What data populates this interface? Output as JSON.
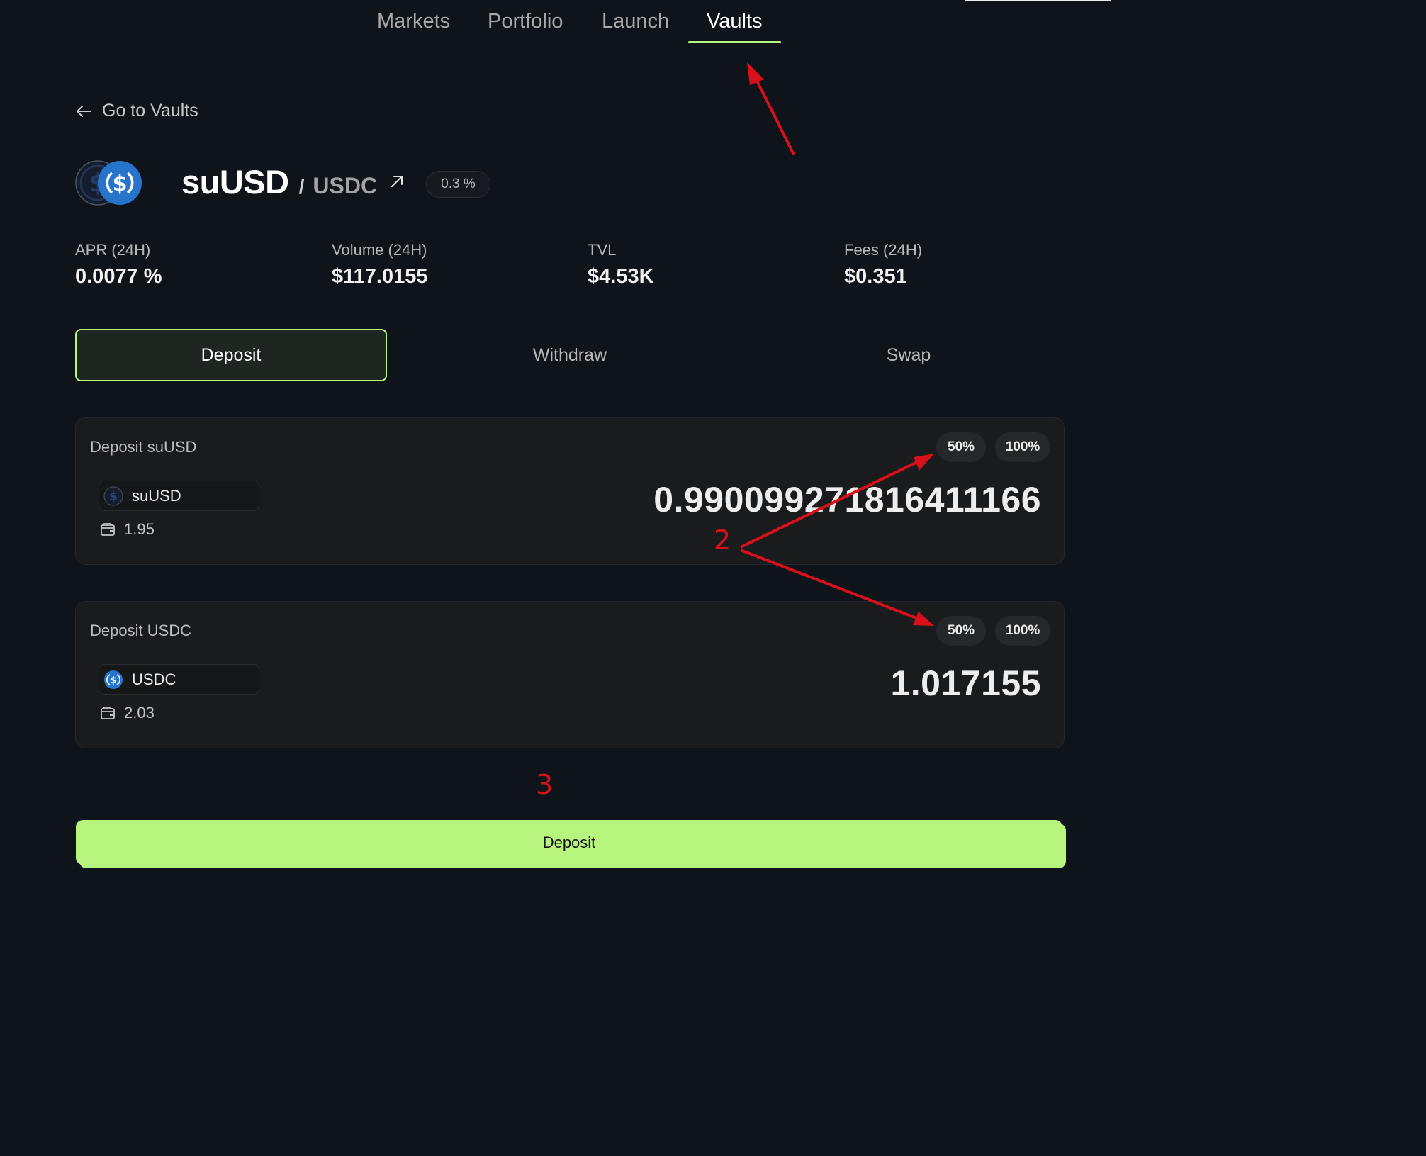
{
  "nav": {
    "tabs": [
      {
        "label": "Markets"
      },
      {
        "label": "Portfolio"
      },
      {
        "label": "Launch"
      },
      {
        "label": "Vaults"
      }
    ],
    "active": "Vaults"
  },
  "back_link": "Go to Vaults",
  "pair": {
    "base": "suUSD",
    "separator": "/",
    "quote": "USDC",
    "fee_badge": "0.3 %"
  },
  "stats": [
    {
      "label": "APR (24H)",
      "value": "0.0077 %"
    },
    {
      "label": "Volume (24H)",
      "value": "$117.0155"
    },
    {
      "label": "TVL",
      "value": "$4.53K"
    },
    {
      "label": "Fees (24H)",
      "value": "$0.351"
    }
  ],
  "action_tabs": [
    {
      "label": "Deposit"
    },
    {
      "label": "Withdraw"
    },
    {
      "label": "Swap"
    }
  ],
  "cards": [
    {
      "label": "Deposit suUSD",
      "token": "suUSD",
      "balance": "1.95",
      "amount": "0.990099271816411166",
      "pct_50": "50%",
      "pct_100": "100%"
    },
    {
      "label": "Deposit USDC",
      "token": "USDC",
      "balance": "2.03",
      "amount": "1.017155",
      "pct_50": "50%",
      "pct_100": "100%"
    }
  ],
  "deposit_button": "Deposit",
  "annotations": {
    "step_2": "2",
    "step_3": "3"
  },
  "colors": {
    "accent": "#b7f57e",
    "background": "#0f131a",
    "annotation": "#d8101c",
    "usdc_blue": "#2775ca"
  }
}
